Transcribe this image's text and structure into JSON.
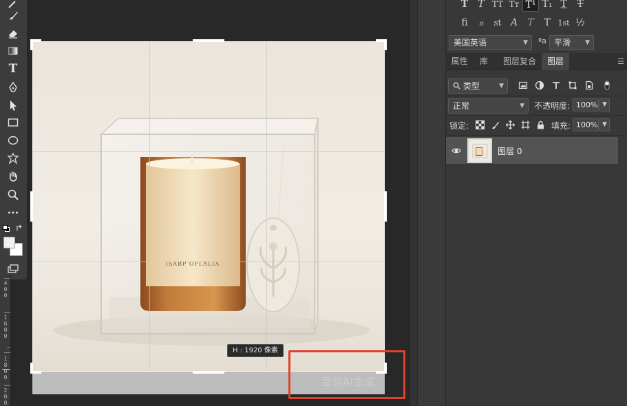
{
  "tools": {
    "icons": [
      "brush-icon",
      "eraser-icon",
      "gradient-icon",
      "type-tool-icon",
      "pen-icon",
      "path-selection-icon",
      "rectangle-icon",
      "ellipse-icon",
      "custom-shape-icon",
      "hand-icon",
      "zoom-icon",
      "more-tools-icon",
      "default-colors-icon",
      "swap-colors-icon",
      "foreground-color-icon",
      "background-color-icon",
      "screen-mode-icon"
    ],
    "type_glyph": "T",
    "foreground_color": "#f2f2f2",
    "background_color": "#ffffff"
  },
  "ruler": {
    "numbers": [
      "4",
      "0",
      "0",
      "1",
      "6",
      "0",
      "0",
      "1",
      "8",
      "0",
      "0",
      "2",
      "0",
      "0"
    ]
  },
  "canvas": {
    "size_tooltip": "H : 1920 像素",
    "watermark": "豆包AI生成",
    "product_label": "ISABP OFLALIA",
    "highlight_color": "#e0412c"
  },
  "character": {
    "row1": [
      {
        "glyph": "T",
        "name": "faux-bold-button",
        "active": false
      },
      {
        "glyph": "T",
        "name": "faux-italic-button",
        "active": false
      },
      {
        "glyph": "TT",
        "name": "all-caps-button",
        "active": false
      },
      {
        "glyph": "Tт",
        "name": "small-caps-button",
        "active": false
      },
      {
        "glyph": "T¹",
        "name": "superscript-button",
        "active": true
      },
      {
        "glyph": "T₁",
        "name": "subscript-button",
        "active": false
      },
      {
        "glyph": "T",
        "name": "underline-button",
        "active": false
      },
      {
        "glyph": "T",
        "name": "strikethrough-button",
        "active": false
      }
    ],
    "row2": [
      {
        "glyph": "ﬁ",
        "name": "standard-ligatures-button"
      },
      {
        "glyph": "ℴ",
        "name": "contextual-alternates-button"
      },
      {
        "glyph": "st",
        "name": "discretionary-ligatures-button"
      },
      {
        "glyph": "A",
        "name": "swash-button"
      },
      {
        "glyph": "T",
        "name": "stylistic-alternates-button"
      },
      {
        "glyph": "T",
        "name": "titling-alternates-button"
      },
      {
        "glyph": "1st",
        "name": "ordinals-button"
      },
      {
        "glyph": "½",
        "name": "fractions-button"
      }
    ],
    "language": "美国英语",
    "antialias_label": "ªa",
    "antialias": "平滑"
  },
  "tabs": [
    "属性",
    "库",
    "图层复合",
    "图层"
  ],
  "active_tab": "图层",
  "layers": {
    "filter_kind": "类型",
    "blend_mode": "正常",
    "opacity_label": "不透明度:",
    "opacity": "100%",
    "lock_label": "锁定:",
    "fill_label": "填充:",
    "fill": "100%",
    "items": [
      {
        "name": "图层 0",
        "visible": true
      }
    ]
  }
}
